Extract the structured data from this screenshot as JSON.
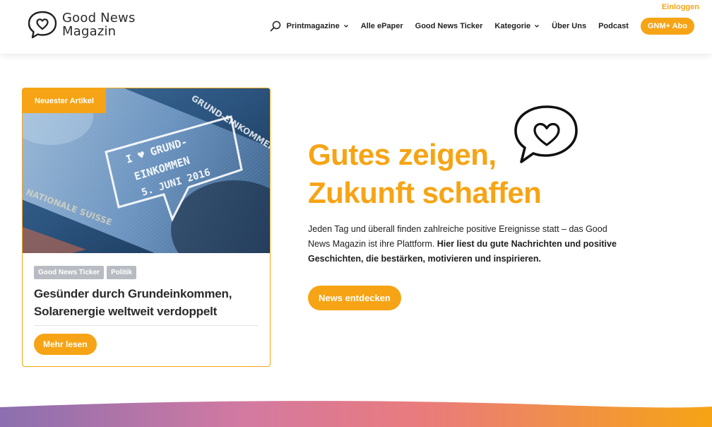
{
  "header": {
    "logo_line1": "Good News",
    "logo_line2": "Magazin",
    "login": "Einloggen",
    "nav": {
      "printmagazine": "Printmagazine",
      "epaper": "Alle ePaper",
      "ticker": "Good News Ticker",
      "kategorie": "Kategorie",
      "ueber_uns": "Über Uns",
      "podcast": "Podcast",
      "abo": "GNM+ Abo"
    }
  },
  "card": {
    "badge": "Neuester Artikel",
    "image_texts": {
      "line1": "I ♥ GRUND-",
      "line2": "EINKOMMEN",
      "line3": "5. JUNI 2016",
      "top": "GRUND-EINKOMMEN",
      "side": "NATIONALE SUISSE"
    },
    "tags": [
      "Good News Ticker",
      "Politik"
    ],
    "title": "Gesünder durch Grundeinkommen, Solarenergie weltweit verdoppelt",
    "more": "Mehr lesen"
  },
  "hero": {
    "title_line1": "Gutes zeigen,",
    "title_line2": "Zukunft schaffen",
    "text_regular": "Jeden Tag und überall finden zahlreiche positive Ereignisse statt – das Good News Magazin ist ihre Plattform. ",
    "text_bold": "Hier liest du gute Nachrichten und positive Geschichten, die bestärken, motivieren und inspirieren.",
    "button": "News entdecken"
  },
  "colors": {
    "accent": "#f6a415",
    "tag_gray": "#b8bcc2",
    "wave_left": "#8b6fb0",
    "wave_mid": "#ea7b7b",
    "wave_right": "#f6a415"
  },
  "icons": {
    "logo": "heart-speech-bubble-icon",
    "search": "search-icon",
    "dropdown": "chevron-down-icon"
  }
}
